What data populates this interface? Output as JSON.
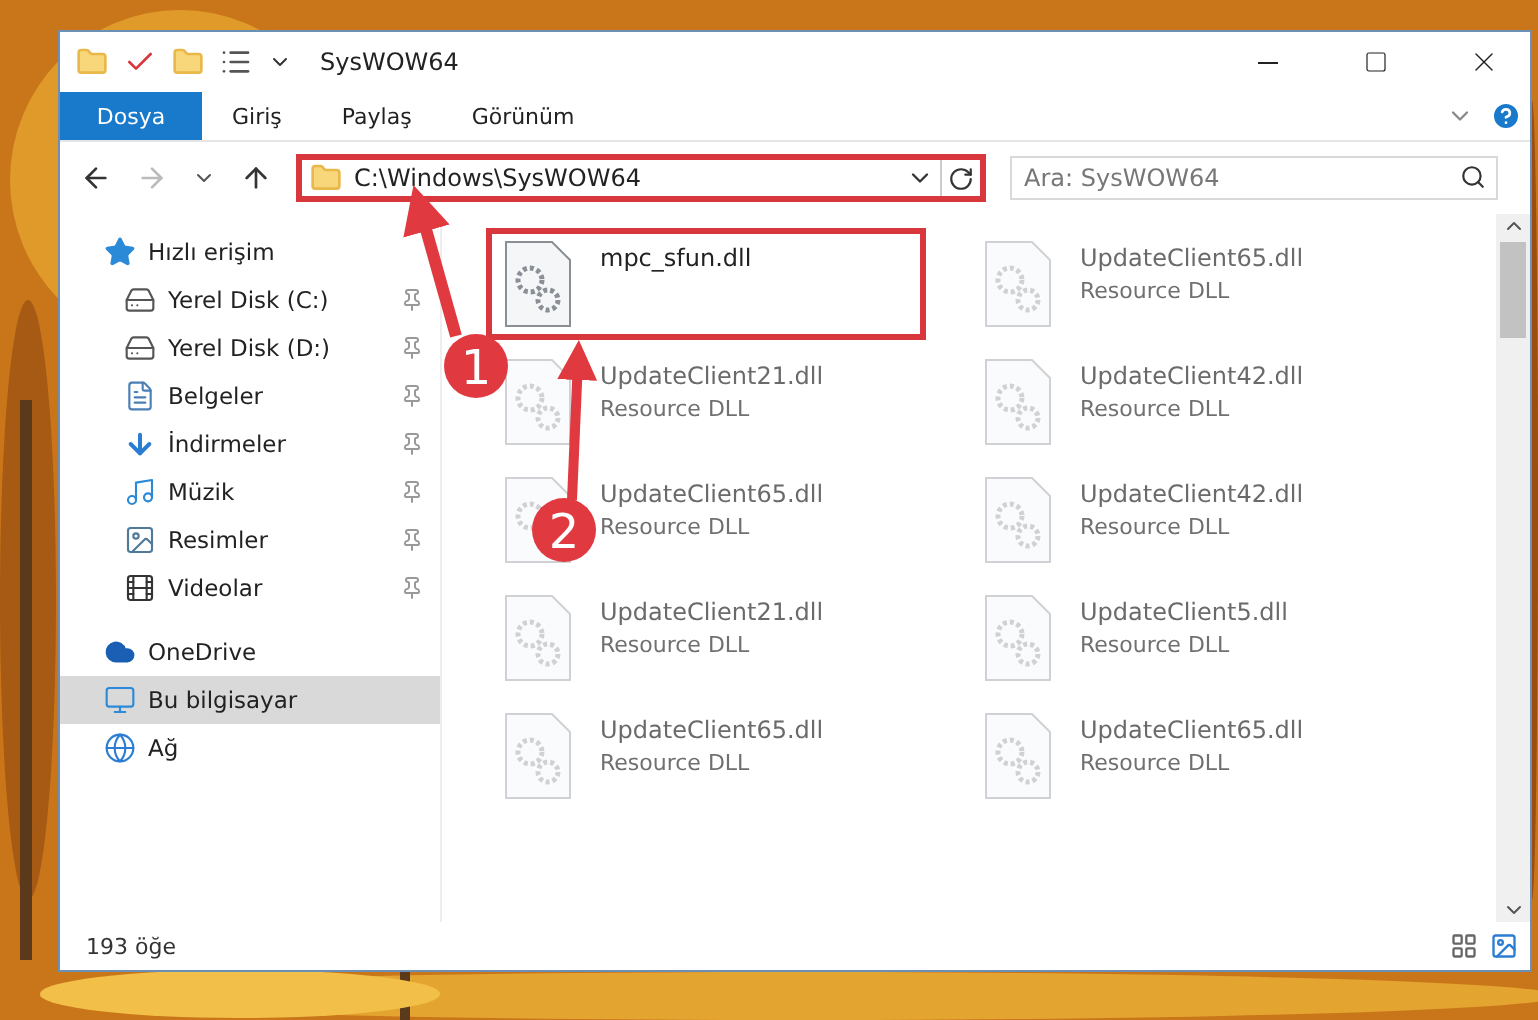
{
  "window": {
    "title": "SysWOW64"
  },
  "ribbon": {
    "tabs": [
      {
        "label": "Dosya",
        "selected": true
      },
      {
        "label": "Giriş",
        "selected": false
      },
      {
        "label": "Paylaş",
        "selected": false
      },
      {
        "label": "Görünüm",
        "selected": false
      }
    ]
  },
  "address": {
    "path": "C:\\Windows\\SysWOW64",
    "highlighted": true
  },
  "search": {
    "placeholder": "Ara: SysWOW64"
  },
  "navigation": [
    {
      "label": "Hızlı erişim",
      "kind": "star",
      "selected": false,
      "children": [
        {
          "label": "Yerel Disk (C:)",
          "kind": "system-drive",
          "selected": false,
          "pinned": true
        },
        {
          "label": "Yerel Disk (D:)",
          "kind": "drive",
          "selected": false,
          "pinned": true
        },
        {
          "label": "Belgeler",
          "kind": "documents",
          "selected": false,
          "pinned": true
        },
        {
          "label": "İndirmeler",
          "kind": "downloads",
          "selected": false,
          "pinned": true
        },
        {
          "label": "Müzik",
          "kind": "music",
          "selected": false,
          "pinned": true
        },
        {
          "label": "Resimler",
          "kind": "pictures",
          "selected": false,
          "pinned": true
        },
        {
          "label": "Videolar",
          "kind": "videos",
          "selected": false,
          "pinned": true
        }
      ]
    },
    {
      "label": "OneDrive",
      "kind": "cloud",
      "selected": false
    },
    {
      "label": "Bu bilgisayar",
      "kind": "computer",
      "selected": true
    },
    {
      "label": "Ağ",
      "kind": "network",
      "selected": false
    }
  ],
  "files": [
    {
      "name": "mpc_sfun.dll",
      "highlighted": true,
      "faded": false
    },
    {
      "name": "UpdateClient65.dll",
      "type": "Resource DLL",
      "highlighted": false,
      "faded": true
    },
    {
      "name": "UpdateClient21.dll",
      "type": "Resource DLL",
      "highlighted": false,
      "faded": true
    },
    {
      "name": "UpdateClient42.dll",
      "type": "Resource DLL",
      "highlighted": false,
      "faded": true
    },
    {
      "name": "UpdateClient65.dll",
      "type": "Resource DLL",
      "highlighted": false,
      "faded": true
    },
    {
      "name": "UpdateClient42.dll",
      "type": "Resource DLL",
      "highlighted": false,
      "faded": true
    },
    {
      "name": "UpdateClient21.dll",
      "type": "Resource DLL",
      "highlighted": false,
      "faded": true
    },
    {
      "name": "UpdateClient5.dll",
      "type": "Resource DLL",
      "highlighted": false,
      "faded": true
    },
    {
      "name": "UpdateClient65.dll",
      "type": "Resource DLL",
      "highlighted": false,
      "faded": true
    },
    {
      "name": "UpdateClient65.dll",
      "type": "Resource DLL",
      "highlighted": false,
      "faded": true
    }
  ],
  "status_bar": {
    "item_count": "193 öğe"
  },
  "annotations": [
    {
      "number": "1"
    },
    {
      "number": "2"
    }
  ]
}
